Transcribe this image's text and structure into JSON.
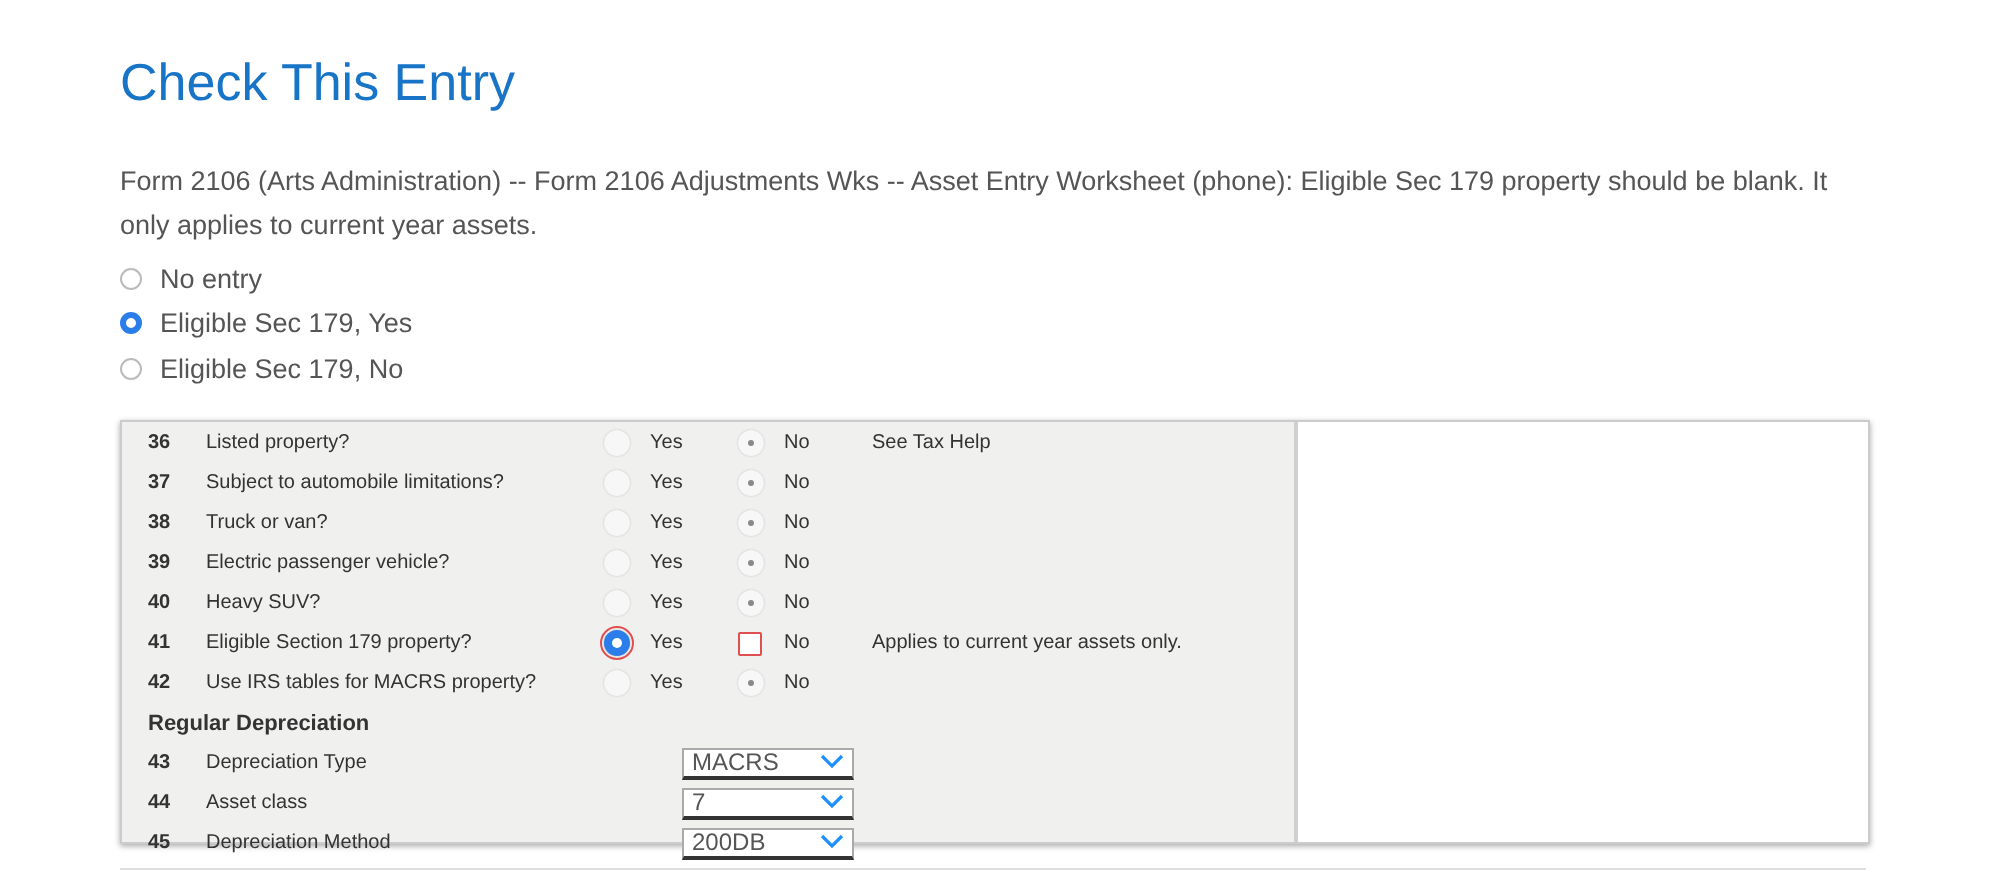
{
  "title": "Check This Entry",
  "message": "Form 2106 (Arts Administration) -- Form 2106 Adjustments Wks -- Asset Entry Worksheet (phone): Eligible Sec 179 property should be blank. It only applies to current year assets.",
  "options": [
    {
      "label": "No entry",
      "selected": false
    },
    {
      "label": "Eligible Sec 179, Yes",
      "selected": true
    },
    {
      "label": "Eligible Sec 179, No",
      "selected": false
    }
  ],
  "worksheet": {
    "rows": [
      {
        "kind": "radio",
        "number": "36",
        "label": "Listed property?",
        "yes_label": "Yes",
        "no_label": "No",
        "yes_selected": false,
        "no_selected": true,
        "flagged": false,
        "note": "See Tax Help"
      },
      {
        "kind": "radio",
        "number": "37",
        "label": "Subject to automobile limitations?",
        "yes_label": "Yes",
        "no_label": "No",
        "yes_selected": false,
        "no_selected": true,
        "flagged": false
      },
      {
        "kind": "radio",
        "number": "38",
        "label": "Truck or van?",
        "yes_label": "Yes",
        "no_label": "No",
        "yes_selected": false,
        "no_selected": true,
        "flagged": false
      },
      {
        "kind": "radio",
        "number": "39",
        "label": "Electric passenger vehicle?",
        "yes_label": "Yes",
        "no_label": "No",
        "yes_selected": false,
        "no_selected": true,
        "flagged": false
      },
      {
        "kind": "radio",
        "number": "40",
        "label": "Heavy SUV?",
        "yes_label": "Yes",
        "no_label": "No",
        "yes_selected": false,
        "no_selected": true,
        "flagged": false
      },
      {
        "kind": "radio",
        "number": "41",
        "label": "Eligible Section 179 property?",
        "yes_label": "Yes",
        "no_label": "No",
        "yes_selected": true,
        "no_selected": false,
        "flagged": true,
        "note": "Applies to current year assets only."
      },
      {
        "kind": "radio",
        "number": "42",
        "label": "Use IRS tables for MACRS property?",
        "yes_label": "Yes",
        "no_label": "No",
        "yes_selected": false,
        "no_selected": true,
        "flagged": false
      },
      {
        "kind": "heading",
        "label": "Regular Depreciation"
      },
      {
        "kind": "select",
        "number": "43",
        "label": "Depreciation Type",
        "value": "MACRS"
      },
      {
        "kind": "select",
        "number": "44",
        "label": "Asset class",
        "value": "7"
      },
      {
        "kind": "select",
        "number": "45",
        "label": "Depreciation Method",
        "value": "200DB"
      }
    ]
  }
}
